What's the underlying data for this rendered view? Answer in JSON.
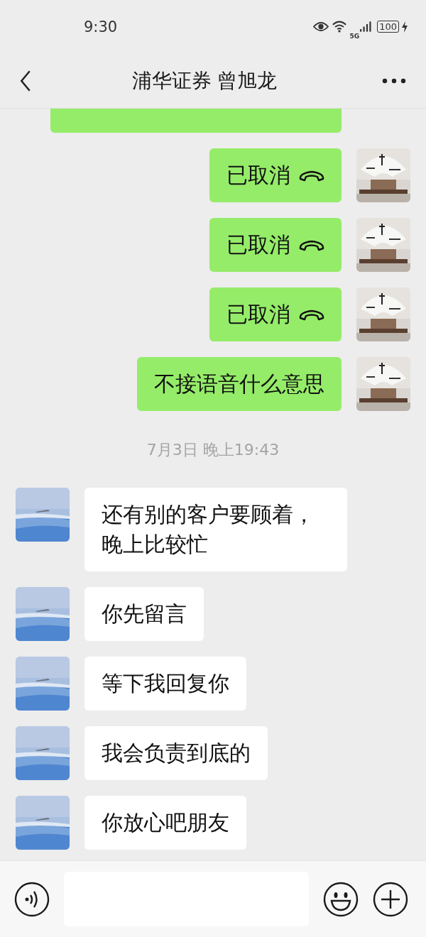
{
  "status_bar": {
    "time": "9:30",
    "network": "5G",
    "battery": "100"
  },
  "header": {
    "title": "浦华证券 曾旭龙"
  },
  "messages": [
    {
      "kind": "cut",
      "outgoing": true
    },
    {
      "kind": "call",
      "outgoing": true,
      "text": "已取消"
    },
    {
      "kind": "call",
      "outgoing": true,
      "text": "已取消"
    },
    {
      "kind": "call",
      "outgoing": true,
      "text": "已取消"
    },
    {
      "kind": "text",
      "outgoing": true,
      "text": "不接语音什么意思"
    },
    {
      "kind": "time",
      "text": "7月3日 晚上19:43"
    },
    {
      "kind": "text",
      "outgoing": false,
      "text": "还有别的客户要顾着，晚上比较忙"
    },
    {
      "kind": "text",
      "outgoing": false,
      "text": "你先留言"
    },
    {
      "kind": "text",
      "outgoing": false,
      "text": "等下我回复你"
    },
    {
      "kind": "text",
      "outgoing": false,
      "text": "我会负责到底的"
    },
    {
      "kind": "text",
      "outgoing": false,
      "text": "你放心吧朋友"
    }
  ]
}
